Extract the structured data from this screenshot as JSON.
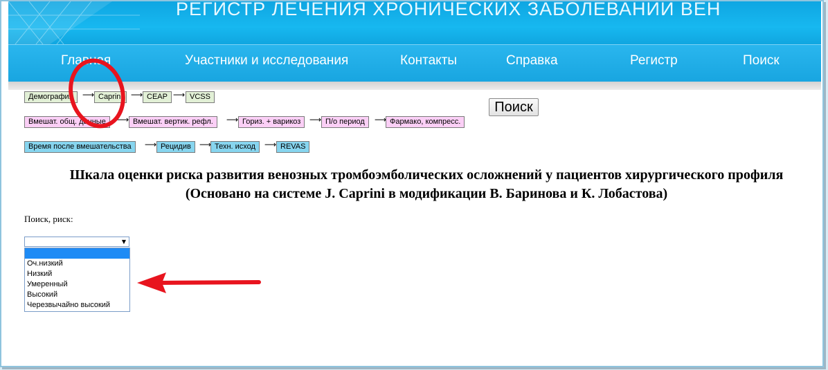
{
  "banner": {
    "title": "РЕГИСТР ЛЕЧЕНИЯ ХРОНИЧЕСКИХ ЗАБОЛЕВАНИЙ ВЕН"
  },
  "nav": {
    "items": [
      "Главная",
      "Участники и исследования",
      "Контакты",
      "Справка",
      "Регистр",
      "Поиск"
    ]
  },
  "breadcrumbs": {
    "row1": [
      "Демография",
      "Caprini",
      "CEAP",
      "VCSS"
    ],
    "row2": [
      "Вмешат. общ. данные",
      "Вмешат. вертик. рефл.",
      "Гориз. + варикоз",
      "П/о период",
      "Фармако, компресс."
    ],
    "row3": [
      "Время после вмешательства",
      "Рецидив",
      "Техн. исход",
      "REVAS"
    ],
    "arrow": "⟶"
  },
  "search_button": "Поиск",
  "heading": {
    "line1": "Шкала оценки риска развития венозных тромбоэмболических осложнений у пациентов хирургического профиля",
    "line2": "(Основано на системе J. Caprini в модификации В. Баринова и К. Лобастова)"
  },
  "risk_search": {
    "label": "Поиск, риск:",
    "selected_value": "",
    "options": [
      "",
      "Оч.низкий",
      "Низкий",
      "Умеренный",
      "Высокий",
      "Черезвычайно высокий"
    ]
  },
  "colors": {
    "banner": "#12abe6",
    "nav": "#1fa9e4",
    "chip_green": "#e2f0d6",
    "chip_pink": "#fbcff6",
    "chip_cyan": "#87d5ef",
    "annotation_red": "#e8141e",
    "option_highlight": "#1e8bf5"
  },
  "annotations": {
    "circle_icon": "red-circle-icon",
    "arrow_icon": "red-arrow-icon"
  }
}
